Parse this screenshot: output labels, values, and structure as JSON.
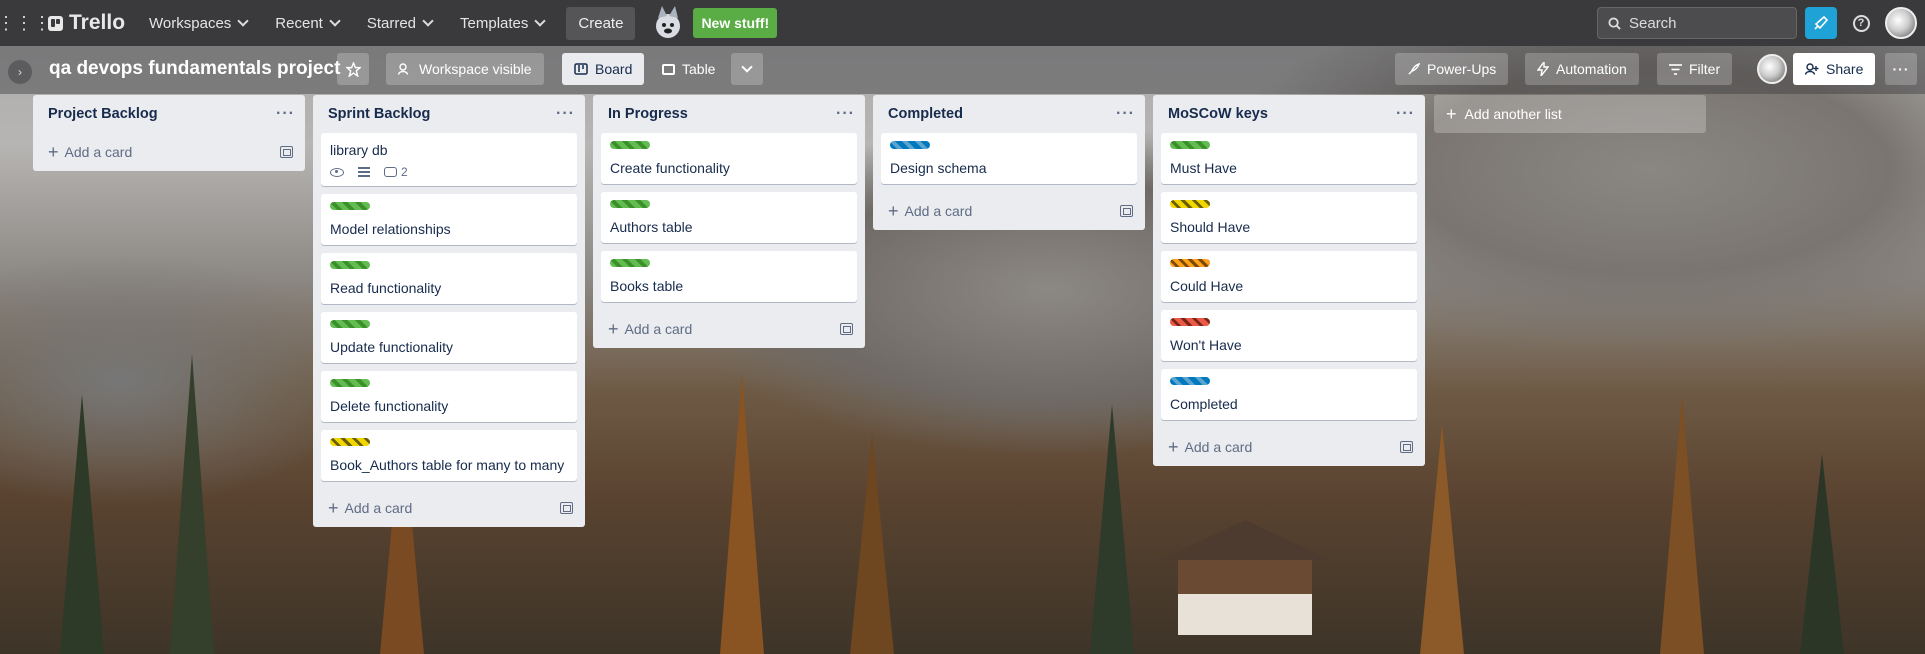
{
  "topbar": {
    "app_name": "Trello",
    "nav": [
      "Workspaces",
      "Recent",
      "Starred",
      "Templates"
    ],
    "create_label": "Create",
    "new_stuff_label": "New stuff!",
    "search_placeholder": "Search"
  },
  "board": {
    "title": "qa devops fundamentals project",
    "visibility_label": "Workspace visible",
    "views": [
      "Board",
      "Table"
    ],
    "powerups_label": "Power-Ups",
    "automation_label": "Automation",
    "filter_label": "Filter",
    "share_label": "Share"
  },
  "lists": [
    {
      "title": "Project Backlog",
      "add_label": "Add a card",
      "cards": []
    },
    {
      "title": "Sprint Backlog",
      "add_label": "Add a card",
      "cards": [
        {
          "title": "library db",
          "label": null,
          "comments": "2"
        },
        {
          "title": "Model relationships",
          "label": "green"
        },
        {
          "title": "Read functionality",
          "label": "green"
        },
        {
          "title": "Update functionality",
          "label": "green"
        },
        {
          "title": "Delete functionality",
          "label": "green"
        },
        {
          "title": "Book_Authors table for many to many",
          "label": "yellow"
        }
      ]
    },
    {
      "title": "In Progress",
      "add_label": "Add a card",
      "cards": [
        {
          "title": "Create functionality",
          "label": "green"
        },
        {
          "title": "Authors table",
          "label": "green"
        },
        {
          "title": "Books table",
          "label": "green"
        }
      ]
    },
    {
      "title": "Completed",
      "add_label": "Add a card",
      "cards": [
        {
          "title": "Design schema",
          "label": "blue"
        }
      ]
    },
    {
      "title": "MoSCoW keys",
      "add_label": "Add a card",
      "cards": [
        {
          "title": "Must Have",
          "label": "green"
        },
        {
          "title": "Should Have",
          "label": "yellow"
        },
        {
          "title": "Could Have",
          "label": "orange"
        },
        {
          "title": "Won't Have",
          "label": "red"
        },
        {
          "title": "Completed",
          "label": "blue"
        }
      ]
    }
  ],
  "add_list_label": "Add another list",
  "colors": {
    "green": "#61bd4f",
    "yellow": "#f2d600",
    "orange": "#ff9f1a",
    "red": "#eb5a46",
    "blue": "#0079bf",
    "new_stuff": "#5aac44",
    "notify": "#1fa3d6"
  }
}
